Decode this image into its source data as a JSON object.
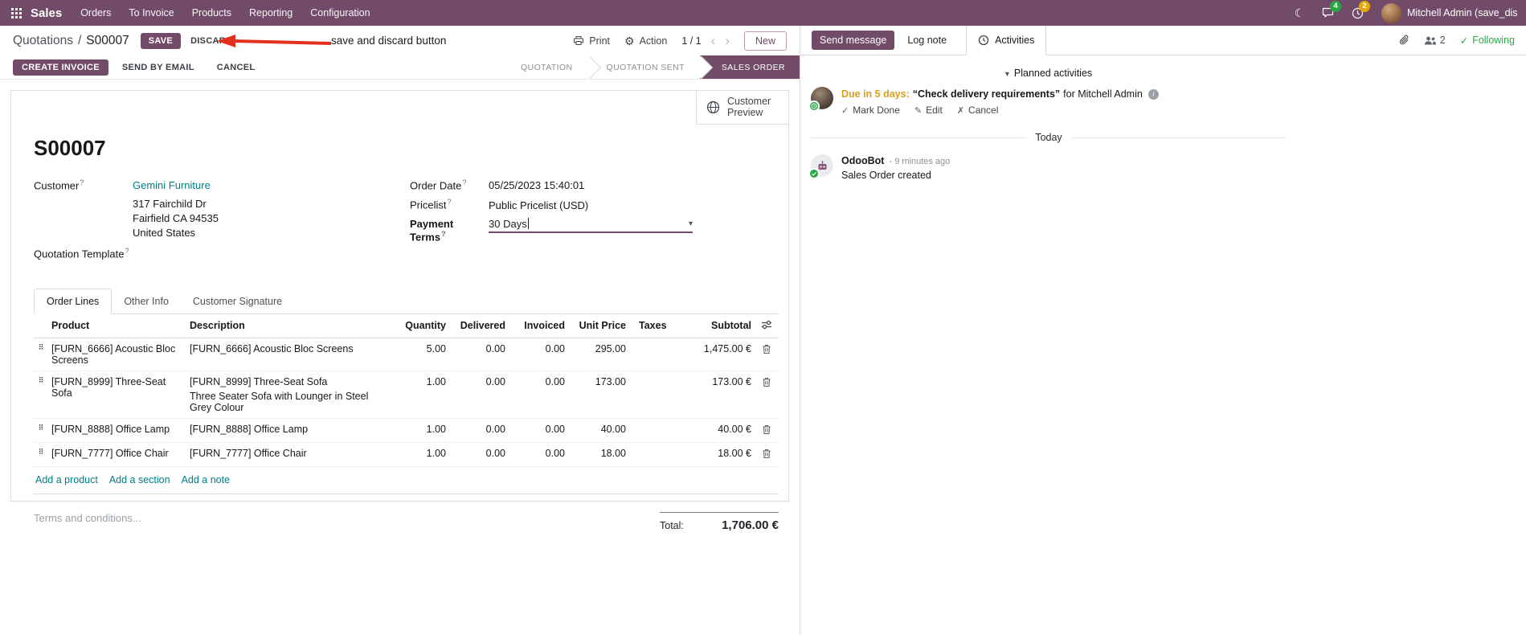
{
  "topbar": {
    "app_name": "Sales",
    "menus": [
      "Orders",
      "To Invoice",
      "Products",
      "Reporting",
      "Configuration"
    ],
    "messages_badge": "4",
    "activities_badge": "2",
    "user_name": "Mitchell Admin (save_discar"
  },
  "control_panel": {
    "breadcrumb_parent": "Quotations",
    "breadcrumb_sep": "/",
    "breadcrumb_current": "S00007",
    "save": "SAVE",
    "discard": "DISCARD",
    "print": "Print",
    "action": "Action",
    "pager": "1 / 1",
    "new": "New"
  },
  "annotation": {
    "text": "save and discard button",
    "color": "#e2301d"
  },
  "statusbar": {
    "create_invoice": "CREATE INVOICE",
    "send_by_email": "SEND BY EMAIL",
    "cancel": "CANCEL",
    "states": [
      {
        "label": "QUOTATION",
        "active": false
      },
      {
        "label": "QUOTATION SENT",
        "active": false
      },
      {
        "label": "SALES ORDER",
        "active": true
      }
    ]
  },
  "form": {
    "customer_preview": "Customer Preview",
    "title": "S00007",
    "customer_label": "Customer",
    "customer_value": "Gemini Furniture",
    "address": [
      "317 Fairchild Dr",
      "Fairfield CA 94535",
      "United States"
    ],
    "quotation_template_label": "Quotation Template",
    "order_date_label": "Order Date",
    "order_date_value": "05/25/2023 15:40:01",
    "pricelist_label": "Pricelist",
    "pricelist_value": "Public Pricelist (USD)",
    "payment_terms_label": "Payment Terms",
    "payment_terms_value": "30 Days",
    "tabs": [
      "Order Lines",
      "Other Info",
      "Customer Signature"
    ],
    "table": {
      "headers": {
        "product": "Product",
        "description": "Description",
        "quantity": "Quantity",
        "delivered": "Delivered",
        "invoiced": "Invoiced",
        "unit_price": "Unit Price",
        "taxes": "Taxes",
        "subtotal": "Subtotal"
      },
      "rows": [
        {
          "product": "[FURN_6666] Acoustic Bloc Screens",
          "description": "[FURN_6666] Acoustic Bloc Screens",
          "description2": "",
          "quantity": "5.00",
          "delivered": "0.00",
          "invoiced": "0.00",
          "unit_price": "295.00",
          "taxes": "",
          "subtotal": "1,475.00 €"
        },
        {
          "product": "[FURN_8999] Three-Seat Sofa",
          "description": "[FURN_8999] Three-Seat Sofa",
          "description2": "Three Seater Sofa with Lounger in Steel Grey Colour",
          "quantity": "1.00",
          "delivered": "0.00",
          "invoiced": "0.00",
          "unit_price": "173.00",
          "taxes": "",
          "subtotal": "173.00 €"
        },
        {
          "product": "[FURN_8888] Office Lamp",
          "description": "[FURN_8888] Office Lamp",
          "description2": "",
          "quantity": "1.00",
          "delivered": "0.00",
          "invoiced": "0.00",
          "unit_price": "40.00",
          "taxes": "",
          "subtotal": "40.00 €"
        },
        {
          "product": "[FURN_7777] Office Chair",
          "description": "[FURN_7777] Office Chair",
          "description2": "",
          "quantity": "1.00",
          "delivered": "0.00",
          "invoiced": "0.00",
          "unit_price": "18.00",
          "taxes": "",
          "subtotal": "18.00 €"
        }
      ],
      "add_product": "Add a product",
      "add_section": "Add a section",
      "add_note": "Add a note"
    },
    "terms_placeholder": "Terms and conditions...",
    "total_label": "Total:",
    "total_value": "1,706.00 €"
  },
  "chatter": {
    "send_message": "Send message",
    "log_note": "Log note",
    "activities": "Activities",
    "followers_count": "2",
    "following": "Following",
    "planned_header": "Planned activities",
    "activity": {
      "due": "Due in 5 days:",
      "summary": "“Check delivery requirements”",
      "assignee": "for Mitchell Admin",
      "mark_done": "Mark Done",
      "edit": "Edit",
      "cancel": "Cancel"
    },
    "day_divider": "Today",
    "message": {
      "author": "OdooBot",
      "timestamp": "- 9 minutes ago",
      "body": "Sales Order created"
    }
  },
  "icons": {
    "drag": "⠿",
    "gear": "⚙",
    "moon": "☾",
    "chev_left": "‹",
    "chev_right": "›",
    "caret_down": "▾",
    "check": "✓",
    "pencil": "✎",
    "x": "✗",
    "help": "?",
    "info": "i"
  },
  "colors": {
    "primary": "#714B67",
    "link": "#017e84",
    "modified_value": "#2563eb",
    "due_warning": "#d9a021",
    "success": "#28a745",
    "annotation": "#e2301d"
  }
}
